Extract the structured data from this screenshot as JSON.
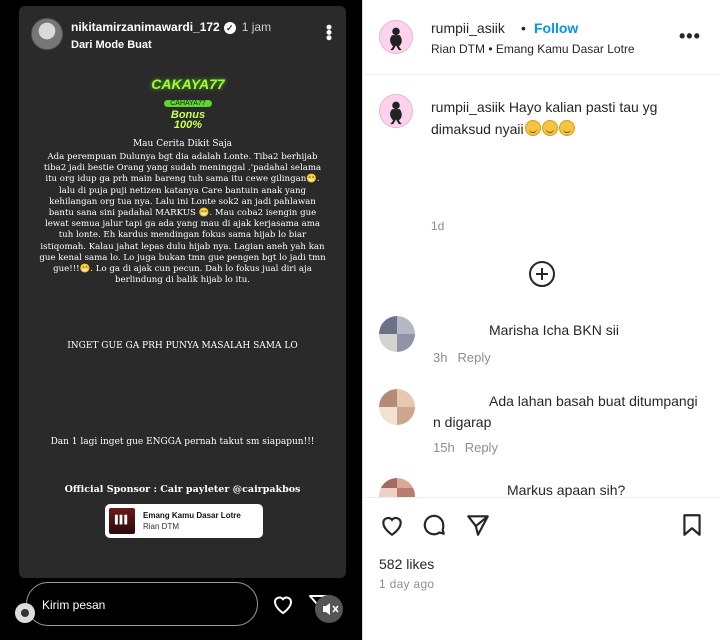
{
  "story": {
    "username": "nikitamirzanimawardi_172",
    "time": "1 jam",
    "subtitle": "Dari Mode Buat",
    "sticker": {
      "brand": "CAKAYA77",
      "pill": "CAHAYA77",
      "bonus_line1": "Bonus",
      "bonus_line2": "100%"
    },
    "text_title": "Mau Cerita Dikit Saja",
    "text_body": "Ada perempuan Dulunya bgt dia adalah Lonte. Tiba2 berhijab tiba2 jadi bestie Orang yang sudah meninggal .'padahal selama itu org idup ga prh main bareng tuh sama itu cewe gilingan😁. lalu di puja puji netizen katanya Care bantuin anak yang kehilangan org tua nya. Lalu ini Lonte sok2 an jadi pahlawan bantu sana sini padahal MARKUS 😁. Mau coba2 isengin gue lewat semua jalur tapi ga ada yang mau di ajak kerjasama ama tuh lonte. Eh kardus mendingan fokus sama hijab lo biar istiqomah. Kalau jahat lepas dulu hijab nya. Lagian aneh yah kan gue kenal sama lo. Lo juga bukan tmn gue pengen bgt lo jadi tmn gue!!!😁. Lo ga di ajak cun pecun. Dah lo fokus jual diri aja berlindung di balik hijab lo itu.",
    "text_inget": "INGET GUE GA PRH PUNYA MASALAH SAMA LO",
    "text_dan": "Dan 1 lagi inget gue ENGGA pernah takut sm siapapun!!!",
    "text_sponsor": "Official Sponsor : Cair payleter @cairpakbos",
    "music_title": "Emang Kamu Dasar Lotre",
    "music_artist": "Rian DTM",
    "reply_placeholder": "Kirim pesan"
  },
  "post": {
    "username": "rumpii_asiik",
    "dot": "•",
    "follow_label": "Follow",
    "music": "Rian DTM • Emang Kamu Dasar Lotre",
    "more": "•••",
    "caption_user": "rumpii_asiik",
    "caption_text": "Hayo kalian pasti tau yg dimaksud nyaii",
    "caption_time": "1d",
    "comments": [
      {
        "text": "Marisha Icha BKN sii",
        "time": "3h",
        "reply": "Reply"
      },
      {
        "text": "Ada lahan basah buat ditumpangi n digarap",
        "time": "15h",
        "reply": "Reply"
      },
      {
        "text": "Markus apaan sih?",
        "time": "",
        "reply": ""
      }
    ],
    "likes": "582 likes",
    "ago": "1 day ago"
  },
  "colors": {
    "accent": "#0095f6",
    "story_bg": "#2a2a2a",
    "muted": "#8e8e8e"
  },
  "icons": [
    "verified-icon",
    "more-icon",
    "heart-icon",
    "send-icon",
    "mute-icon",
    "settings-icon",
    "add-comment-icon",
    "comment-icon",
    "share-icon",
    "save-icon"
  ]
}
